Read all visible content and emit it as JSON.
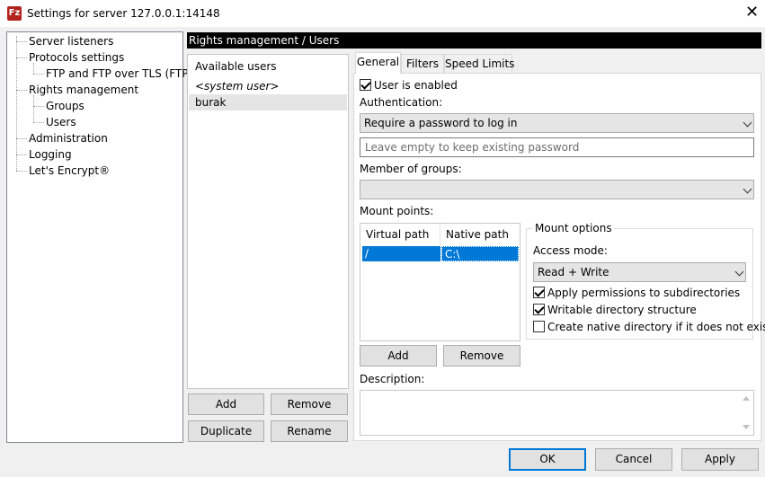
{
  "window": {
    "title": "Settings for server 127.0.0.1:14148",
    "icon_text": "Fz"
  },
  "tree": {
    "items": [
      {
        "label": "Server listeners"
      },
      {
        "label": "Protocols settings"
      },
      {
        "label": "FTP and FTP over TLS (FTPS)"
      },
      {
        "label": "Rights management"
      },
      {
        "label": "Groups"
      },
      {
        "label": "Users"
      },
      {
        "label": "Administration"
      },
      {
        "label": "Logging"
      },
      {
        "label": "Let's Encrypt®"
      }
    ]
  },
  "header": {
    "title": "Rights management / Users"
  },
  "users": {
    "heading": "Available users",
    "items": [
      "<system user>",
      "burak"
    ],
    "selected": "burak",
    "buttons": {
      "add": "Add",
      "remove": "Remove",
      "duplicate": "Duplicate",
      "rename": "Rename"
    }
  },
  "tabs": [
    "General",
    "Filters",
    "Speed Limits"
  ],
  "active_tab": "General",
  "general": {
    "user_enabled_label": "User is enabled",
    "user_enabled": true,
    "authentication_label": "Authentication:",
    "authentication_value": "Require a password to log in",
    "password_placeholder": "Leave empty to keep existing password",
    "member_of_groups_label": "Member of groups:",
    "member_of_groups_value": "",
    "mount_points_label": "Mount points:",
    "mount_columns": [
      "Virtual path",
      "Native path"
    ],
    "mount_rows": [
      {
        "virtual": "/",
        "native": "C:\\"
      }
    ],
    "mount_add": "Add",
    "mount_remove": "Remove",
    "mount_options": {
      "title": "Mount options",
      "access_mode_label": "Access mode:",
      "access_mode_value": "Read + Write",
      "apply_permissions_label": "Apply permissions to subdirectories",
      "apply_permissions": true,
      "writable_label": "Writable directory structure",
      "writable": true,
      "create_native_label": "Create native directory if it does not exist",
      "create_native": false
    },
    "description_label": "Description:",
    "description_value": ""
  },
  "footer": {
    "ok": "OK",
    "cancel": "Cancel",
    "apply": "Apply"
  },
  "colors": {
    "selection": "#0078d7",
    "header_bg": "#000000",
    "icon_red": "#b3231d"
  }
}
